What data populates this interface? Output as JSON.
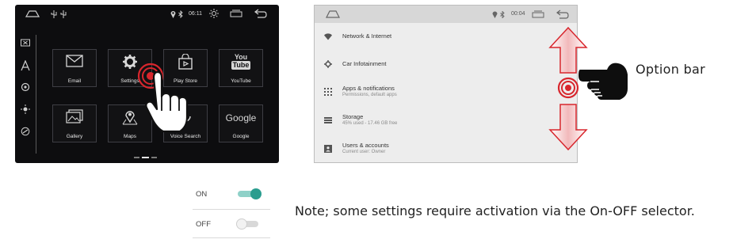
{
  "left_screen": {
    "status": {
      "time": "06:11"
    },
    "apps": [
      {
        "label": "Email",
        "icon": "email-icon"
      },
      {
        "label": "Settings",
        "icon": "gear-icon"
      },
      {
        "label": "Play Store",
        "icon": "shopping-bag-icon"
      },
      {
        "label": "YouTube",
        "icon": "youtube-icon",
        "logo_top": "You",
        "logo_bottom": "Tube"
      },
      {
        "label": "Gallery",
        "icon": "gallery-icon"
      },
      {
        "label": "Maps",
        "icon": "map-pin-icon"
      },
      {
        "label": "Voice Search",
        "icon": "microphone-icon"
      },
      {
        "label": "Google",
        "icon": "google-logo",
        "logo_text": "Google"
      }
    ]
  },
  "right_screen": {
    "status": {
      "time": "00:04"
    },
    "items": [
      {
        "title": "Network & Internet",
        "subtitle": "",
        "icon": "wifi-icon"
      },
      {
        "title": "Car Infotainment",
        "subtitle": "",
        "icon": "gear-icon"
      },
      {
        "title": "Apps & notifications",
        "subtitle": "Permissions, default apps",
        "icon": "apps-grid-icon"
      },
      {
        "title": "Storage",
        "subtitle": "45% used - 17.46 GB free",
        "icon": "storage-icon"
      },
      {
        "title": "Users & accounts",
        "subtitle": "Current user: Owner",
        "icon": "user-icon"
      }
    ]
  },
  "callout": {
    "text": "Option bar"
  },
  "toggles": {
    "on": {
      "label": "ON",
      "state": true,
      "color": "#2a9d8f"
    },
    "off": {
      "label": "OFF",
      "state": false,
      "color": "#c8c8c8"
    }
  },
  "note": "Note; some settings require activation via the On-OFF selector.",
  "colors": {
    "accent_red": "#d8262d",
    "dark_screen": "#0d0d0f",
    "light_screen": "#ededed"
  }
}
